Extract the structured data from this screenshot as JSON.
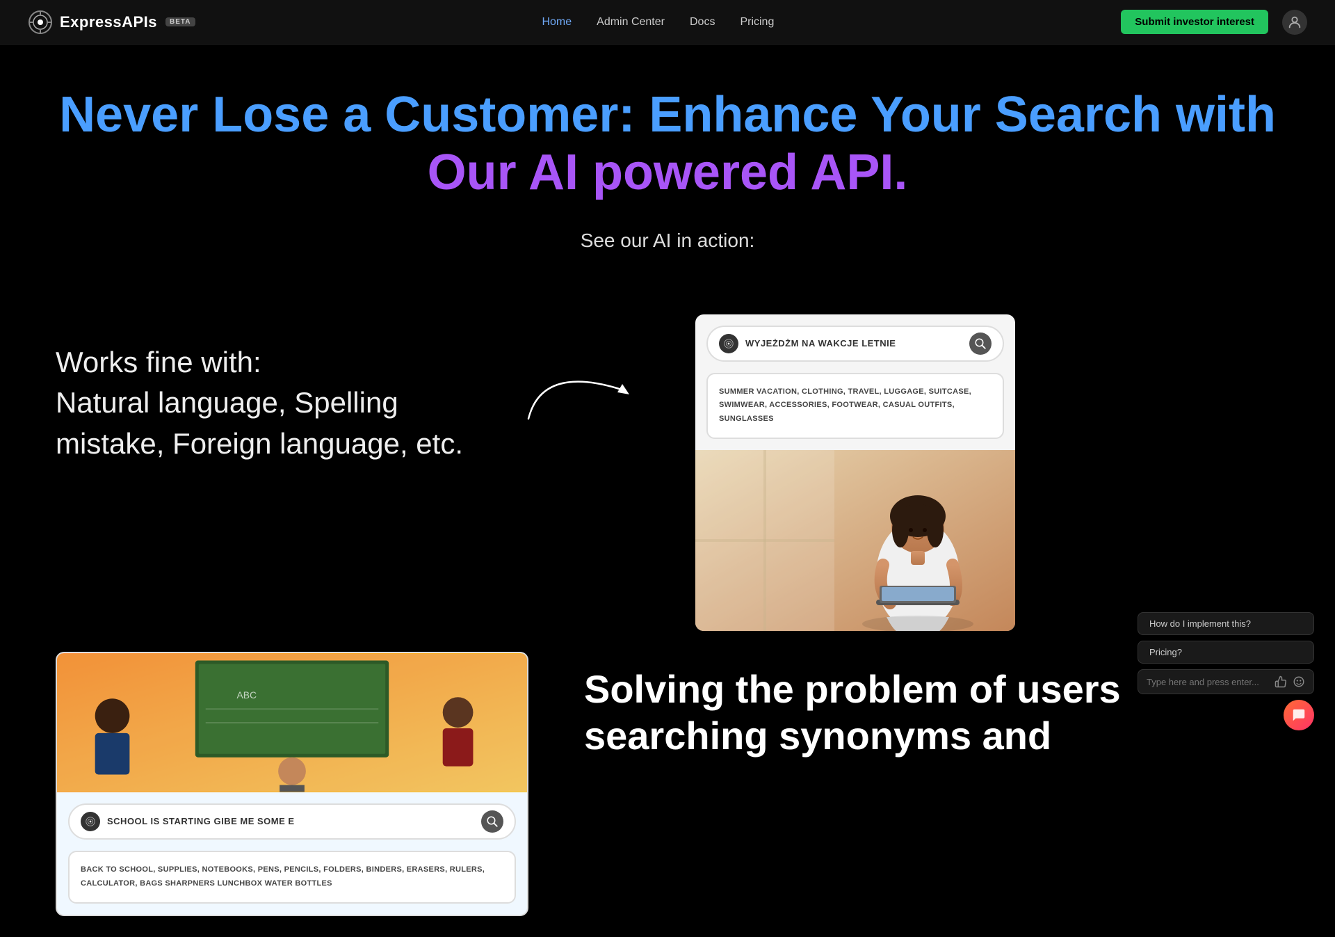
{
  "navbar": {
    "logo_text": "ExpressAPIs",
    "beta_label": "BETA",
    "links": [
      {
        "label": "Home",
        "active": true
      },
      {
        "label": "Admin Center",
        "active": false
      },
      {
        "label": "Docs",
        "active": false
      },
      {
        "label": "Pricing",
        "active": false
      }
    ],
    "submit_btn": "Submit investor interest"
  },
  "hero": {
    "title_part1": "Never Lose a Customer: Enhance Your Search with",
    "title_part2": "Our AI powered API.",
    "subtitle": "See our AI in action:"
  },
  "works_fine": {
    "text": "Works fine with:\nNatural language, Spelling\nmistake, Foreign language, etc."
  },
  "demo_card_top": {
    "search_query": "WYJEŻDŻM NA WAKCJE LETNIE",
    "tags": "SUMMER VACATION, CLOTHING, TRAVEL, LUGGAGE,\nSUITCASE, SWIMWEAR, ACCESSORIES, FOOTWEAR,\nCASUAL OUTFITS, SUNGLASSES"
  },
  "demo_card_bottom": {
    "search_query": "SCHOOL IS STARTING GIBE ME SOME E",
    "tags": "BACK TO SCHOOL, SUPPLIES, NOTEBOOKS, PENS, PENCILS,\nFOLDERS, BINDERS, ERASERS, RULERS, CALCULATOR,\nBAGS SHARPNERS LUNCHBOX WATER BOTTLES"
  },
  "solving": {
    "title": "Solving the problem of users\nsearching synonyms and"
  },
  "chat": {
    "bubble1": "How do I implement this?",
    "bubble2": "Pricing?",
    "input_placeholder": "Type here and press enter..."
  }
}
